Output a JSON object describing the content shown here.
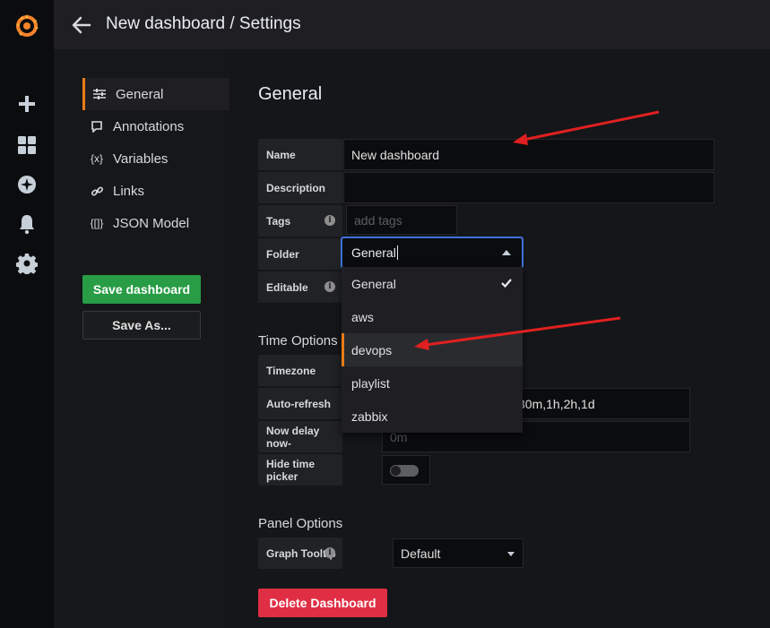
{
  "header": {
    "title": "New dashboard / Settings"
  },
  "sidenav": {
    "items": [
      {
        "label": "General",
        "icon": "sliders-icon",
        "active": true
      },
      {
        "label": "Annotations",
        "icon": "comment-icon"
      },
      {
        "label": "Variables",
        "icon": "variable-icon"
      },
      {
        "label": "Links",
        "icon": "link-icon"
      },
      {
        "label": "JSON Model",
        "icon": "json-icon"
      }
    ],
    "save_label": "Save dashboard",
    "save_as_label": "Save As..."
  },
  "general": {
    "title": "General",
    "name_label": "Name",
    "name_value": "New dashboard",
    "description_label": "Description",
    "description_value": "",
    "tags_label": "Tags",
    "tags_placeholder": "add tags",
    "folder_label": "Folder",
    "folder_value": "General",
    "editable_label": "Editable"
  },
  "folder_dropdown": {
    "options": [
      {
        "label": "General",
        "selected": true
      },
      {
        "label": "aws"
      },
      {
        "label": "devops",
        "highlighted": true
      },
      {
        "label": "playlist"
      },
      {
        "label": "zabbix"
      }
    ]
  },
  "time_options": {
    "title": "Time Options",
    "timezone_label": "Timezone",
    "auto_refresh_label": "Auto-refresh",
    "auto_refresh_value_visible": "30m,1h,2h,1d",
    "now_delay_label": "Now delay now-",
    "now_delay_placeholder": "0m",
    "hide_time_picker_label": "Hide time picker",
    "hide_time_picker_on": false
  },
  "panel_options": {
    "title": "Panel Options",
    "graph_tooltip_label": "Graph Tooltip",
    "graph_tooltip_value": "Default"
  },
  "delete_label": "Delete Dashboard",
  "colors": {
    "accent": "#eb7b18",
    "save": "#299c46",
    "delete": "#e02f44",
    "focus": "#3d71d9",
    "annotation_arrow": "#e02020"
  }
}
